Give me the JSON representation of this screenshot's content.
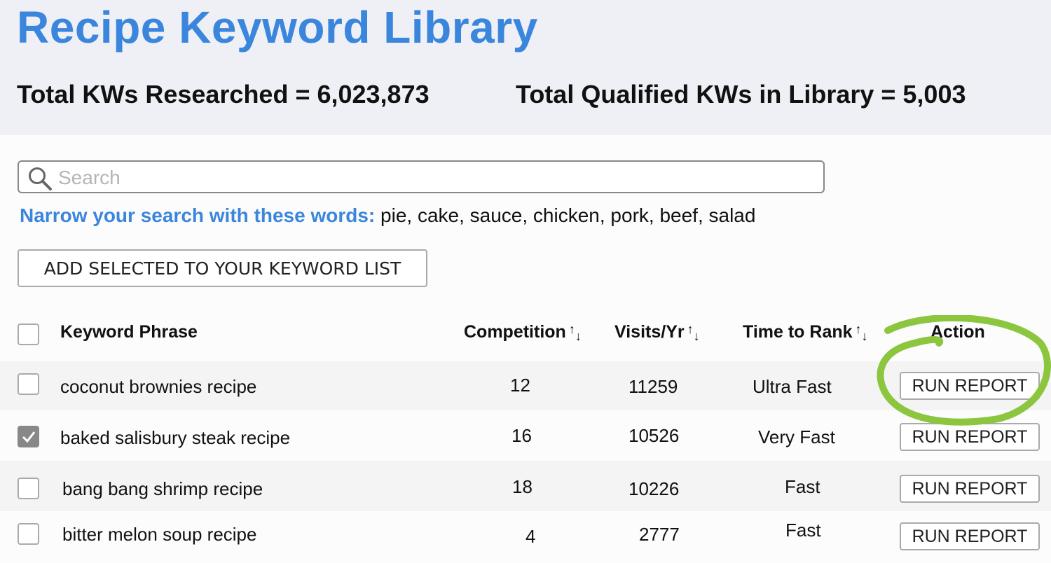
{
  "header": {
    "title": "Recipe Keyword Library",
    "total_researched": "Total KWs Researched = 6,023,873",
    "total_qualified": "Total Qualified KWs in Library = 5,003"
  },
  "search": {
    "placeholder": "Search",
    "value": "",
    "icon": "search-icon"
  },
  "narrow": {
    "label": "Narrow your search with these words:",
    "words": " pie, cake, sauce, chicken, pork, beef, salad"
  },
  "add_button_label": "ADD SELECTED TO YOUR KEYWORD LIST",
  "table": {
    "columns": {
      "keyword": "Keyword Phrase",
      "competition": "Competition",
      "visits": "Visits/Yr",
      "time_to_rank": "Time to Rank",
      "action": "Action"
    },
    "sort_up": "↑",
    "sort_down": "↓",
    "rows": [
      {
        "checked": false,
        "keyword": "coconut brownies recipe",
        "competition": "12",
        "visits": "11259",
        "time_to_rank": "Ultra Fast",
        "action": "RUN REPORT"
      },
      {
        "checked": true,
        "keyword": "baked salisbury steak recipe",
        "competition": "16",
        "visits": "10526",
        "time_to_rank": "Very Fast",
        "action": "RUN REPORT"
      },
      {
        "checked": false,
        "keyword": "bang bang shrimp recipe",
        "competition": "18",
        "visits": "10226",
        "time_to_rank": "Fast",
        "action": "RUN REPORT"
      },
      {
        "checked": false,
        "keyword": "bitter melon soup recipe",
        "competition": "4",
        "visits": "2777",
        "time_to_rank": "Fast",
        "action": "RUN REPORT"
      }
    ]
  },
  "annotation": {
    "color": "#8cc63f",
    "target": "Action column / first RUN REPORT button"
  }
}
